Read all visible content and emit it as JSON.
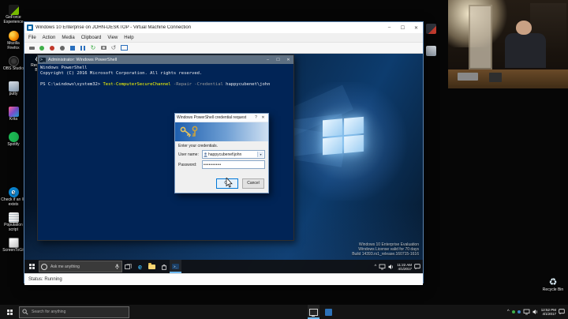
{
  "glyphs": {
    "minimize": "–",
    "maximize": "☐",
    "close": "✕",
    "help": "?",
    "dropdown": "▾",
    "chevron_up": "^",
    "edge": "e",
    "recycle": "♻",
    "ps_icon": ">_",
    "reset": "↻",
    "revert": "↺"
  },
  "host": {
    "desktop_icons": [
      {
        "label": "GeForce Experience"
      },
      {
        "label": "Mozilla Firefox"
      },
      {
        "label": "OBS Studio"
      },
      {
        "label": "putty"
      },
      {
        "label": "Krita"
      },
      {
        "label": "Spotify"
      },
      {
        "label": "Check if an ID exists"
      },
      {
        "label": "Population script"
      },
      {
        "label": "ScreenToGif"
      }
    ],
    "recycle_bin_label": "Recycle Bin",
    "taskbar": {
      "search_placeholder": "Search for anything",
      "time": "12:52 PM",
      "date": "4/1/2017"
    }
  },
  "vm_window": {
    "title": "Windows 10 Enterprise on JOHN-DESKTOP - Virtual Machine Connection",
    "menu_items": [
      "File",
      "Action",
      "Media",
      "Clipboard",
      "View",
      "Help"
    ],
    "status_text": "Status: Running"
  },
  "vm_desktop": {
    "recycle_bin_label": "Recycle Bin",
    "taskbar_search_placeholder": "Ask me anything",
    "tray_time": "11:22 AM",
    "tray_date": "4/1/2017",
    "watermark_line1": "Windows 10 Enterprise Evaluation",
    "watermark_line2": "Windows License valid for 70 days",
    "watermark_line3": "Build 14393.rs1_release.160715-1616"
  },
  "powershell": {
    "title": "Administrator: Windows PowerShell",
    "line1": "Windows PowerShell",
    "line2": "Copyright (C) 2016 Microsoft Corporation. All rights reserved.",
    "prompt": "PS C:\\windows\\system32>",
    "cmdlet": "Test-ComputerSecureChannel",
    "param_repair": "-Repair",
    "param_credential": "-Credential",
    "credential_arg": "happycubenet\\john"
  },
  "credential_dialog": {
    "title": "Windows PowerShell credential request",
    "prompt": "Enter your credentials.",
    "username_label": "User name:",
    "username_value": "happycubenet\\john",
    "password_label": "Password:",
    "password_value": "••••••••••",
    "ok_label": "OK",
    "cancel_label": "Cancel"
  }
}
